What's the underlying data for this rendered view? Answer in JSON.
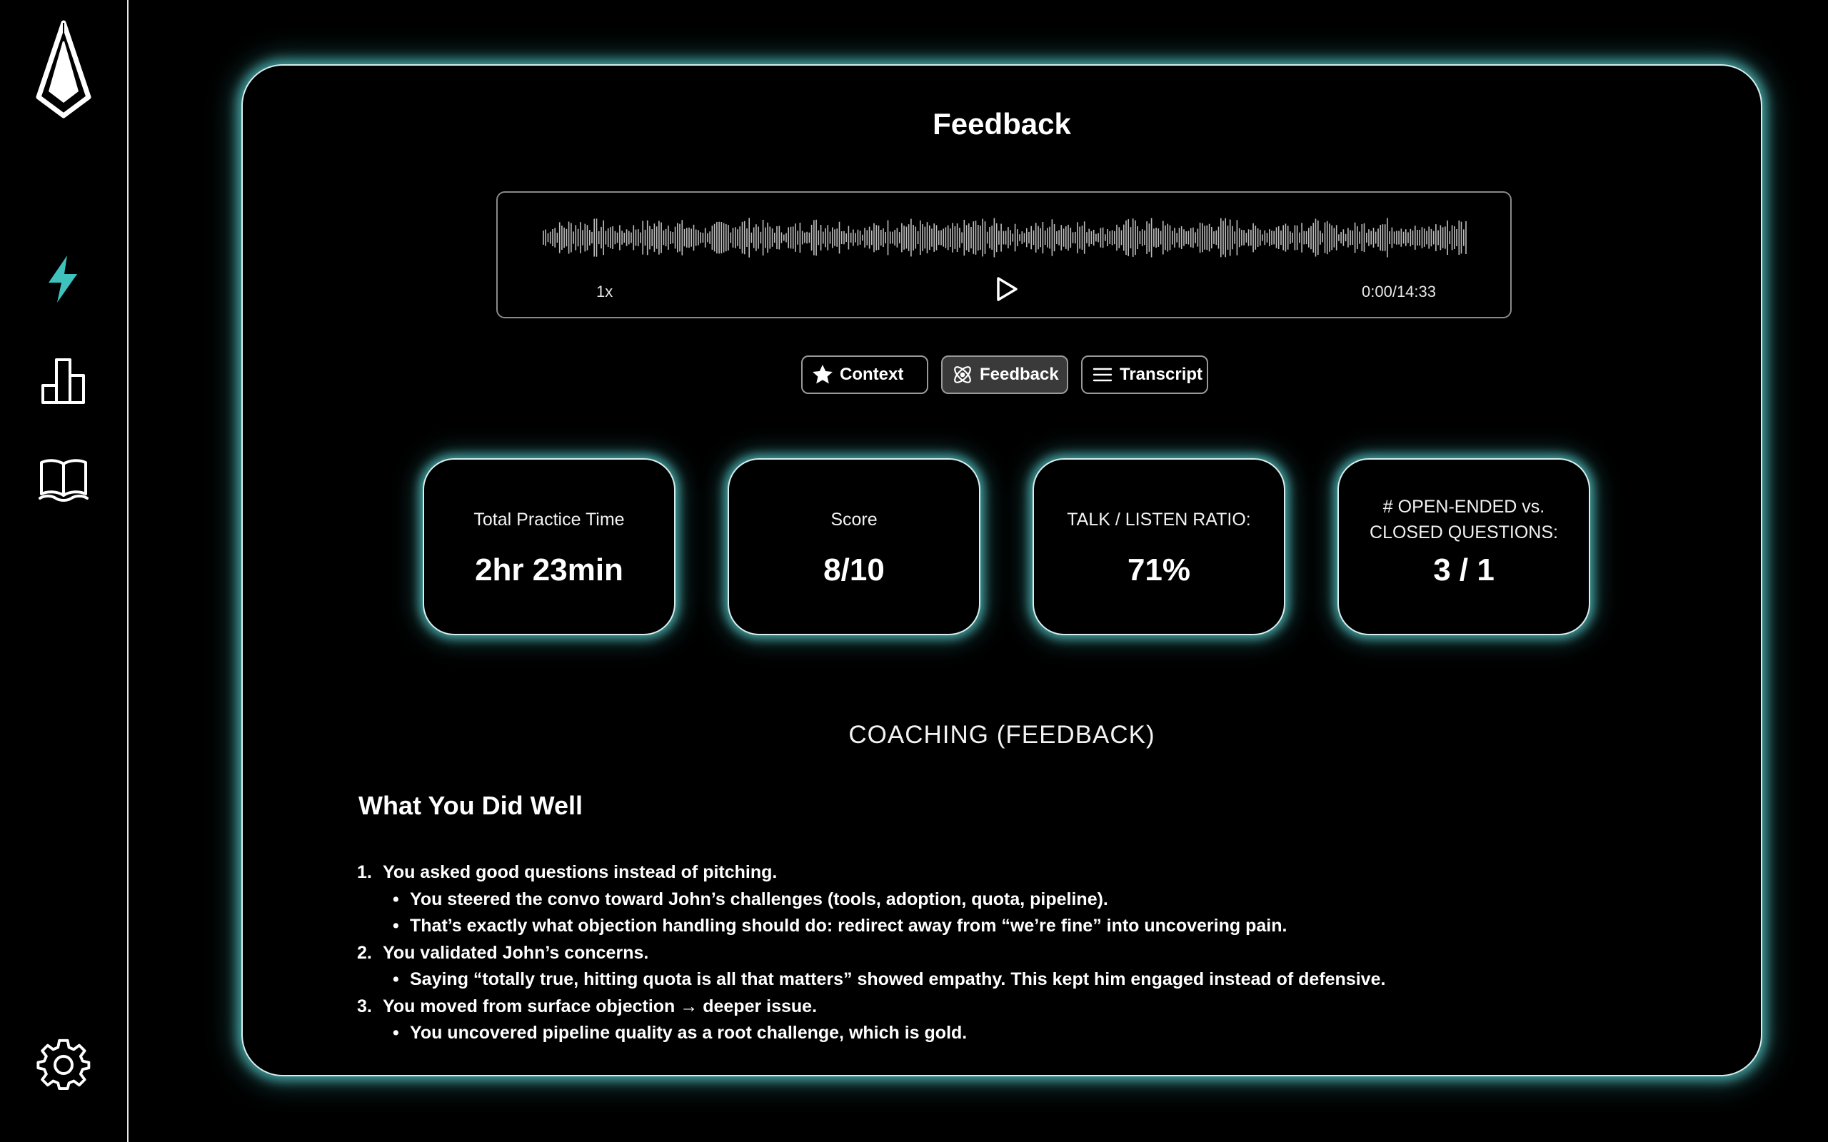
{
  "sidebar": {
    "items": [
      {
        "name": "bolt-icon",
        "active": true
      },
      {
        "name": "bar-chart-icon"
      },
      {
        "name": "book-icon"
      },
      {
        "name": "gear-icon"
      }
    ]
  },
  "colors": {
    "accent": "#3fc1bd",
    "glow": "#4eb2b2",
    "background": "#000000",
    "text": "#ffffff",
    "tab_active_bg": "#3a3a3a"
  },
  "page": {
    "title": "Feedback"
  },
  "audio": {
    "speed": "1x",
    "time": "0:00/14:33"
  },
  "tabs": [
    {
      "label": "Context",
      "icon": "star-icon"
    },
    {
      "label": "Feedback",
      "icon": "atom-icon",
      "active": true
    },
    {
      "label": "Transcript",
      "icon": "list-icon"
    }
  ],
  "stats": [
    {
      "label": "Total Practice Time",
      "value": "2hr 23min"
    },
    {
      "label": "Score",
      "value": "8/10"
    },
    {
      "label": "TALK / LISTEN RATIO:",
      "value": "71%"
    },
    {
      "label": "# OPEN-ENDED vs. CLOSED QUESTIONS:",
      "value": "3 / 1"
    }
  ],
  "coaching": {
    "title": "COACHING (FEEDBACK)",
    "section_heading": "What You Did Well",
    "points": [
      {
        "number": "1.",
        "text": "You asked good questions instead of pitching.",
        "subs": [
          "You steered the convo toward John’s challenges (tools, adoption, quota, pipeline).",
          "That’s exactly what objection handling should do: redirect away from “we’re fine” into uncovering pain."
        ]
      },
      {
        "number": "2.",
        "text": "You validated John’s concerns.",
        "subs": [
          "Saying “totally true, hitting quota is all that matters” showed empathy. This kept him engaged instead of defensive."
        ]
      },
      {
        "number": "3.",
        "text": "You moved from surface objection → deeper issue.",
        "subs": [
          "You uncovered pipeline quality as a root challenge, which is gold."
        ]
      }
    ]
  }
}
